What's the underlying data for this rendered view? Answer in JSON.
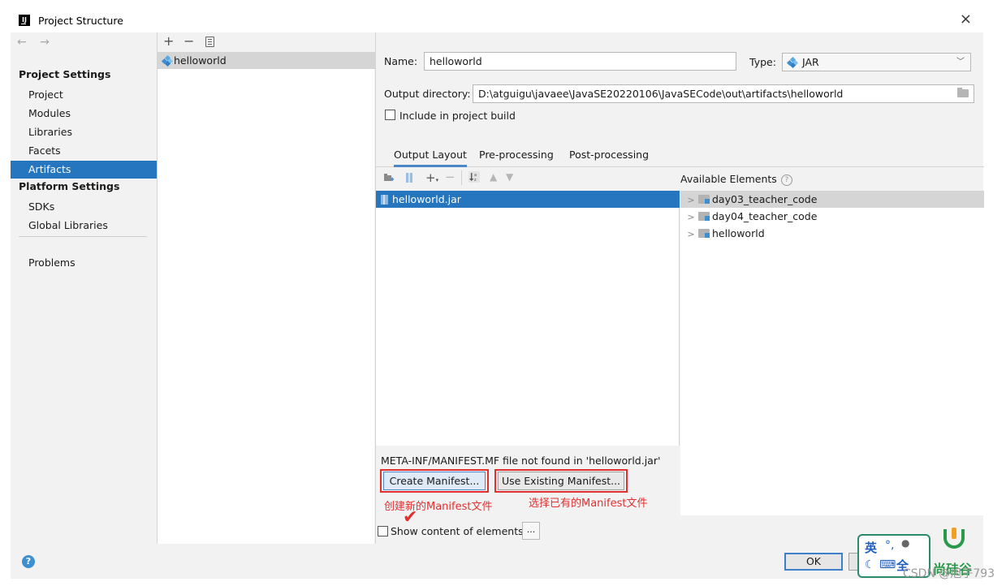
{
  "window": {
    "title": "Project Structure",
    "close_symbol": "×"
  },
  "nav": {
    "back_forward": "← →",
    "project_settings_header": "Project Settings",
    "project_settings_items": [
      "Project",
      "Modules",
      "Libraries",
      "Facets",
      "Artifacts"
    ],
    "platform_settings_header": "Platform Settings",
    "platform_settings_items": [
      "SDKs",
      "Global Libraries"
    ],
    "problems": "Problems",
    "selected": "Artifacts"
  },
  "artifact_list": {
    "toolbar": {
      "add": "+",
      "remove": "−"
    },
    "items": [
      "helloworld"
    ]
  },
  "artifact": {
    "name_label": "Name:",
    "name_value": "helloworld",
    "type_label": "Type:",
    "type_value": "JAR",
    "output_dir_label": "Output directory:",
    "output_dir_value": "D:\\atguigu\\javaee\\JavaSE20220106\\JavaSECode\\out\\artifacts\\helloworld",
    "include_in_build_label": "Include in project build",
    "include_in_build_checked": false
  },
  "tabs": [
    "Output Layout",
    "Pre-processing",
    "Post-processing"
  ],
  "active_tab": "Output Layout",
  "output_layout": {
    "tree_items": [
      "helloworld.jar"
    ]
  },
  "available_elements": {
    "header": "Available Elements",
    "help": "?",
    "items": [
      "day03_teacher_code",
      "day04_teacher_code",
      "helloworld"
    ]
  },
  "manifest": {
    "message": "META-INF/MANIFEST.MF file not found in 'helloworld.jar'",
    "create_button": "Create Manifest...",
    "use_existing_button": "Use Existing Manifest...",
    "annotation_create": "创建新的Manifest文件",
    "annotation_existing": "选择已有的Manifest文件",
    "annotation_check": "✔"
  },
  "show_content": {
    "label": "Show content of elements",
    "checked": false,
    "more_button": "..."
  },
  "footer": {
    "help": "?",
    "ok": "OK"
  },
  "overlays": {
    "ime_lang": "英",
    "ime_punct": "°,",
    "ime_full": "全",
    "brand_text": "尚硅谷",
    "watermark": "CSDN @旭子793"
  },
  "colors": {
    "selection_blue": "#2675bf",
    "annotation_red": "#e23030",
    "jar_blue": "#3d8fd0"
  }
}
